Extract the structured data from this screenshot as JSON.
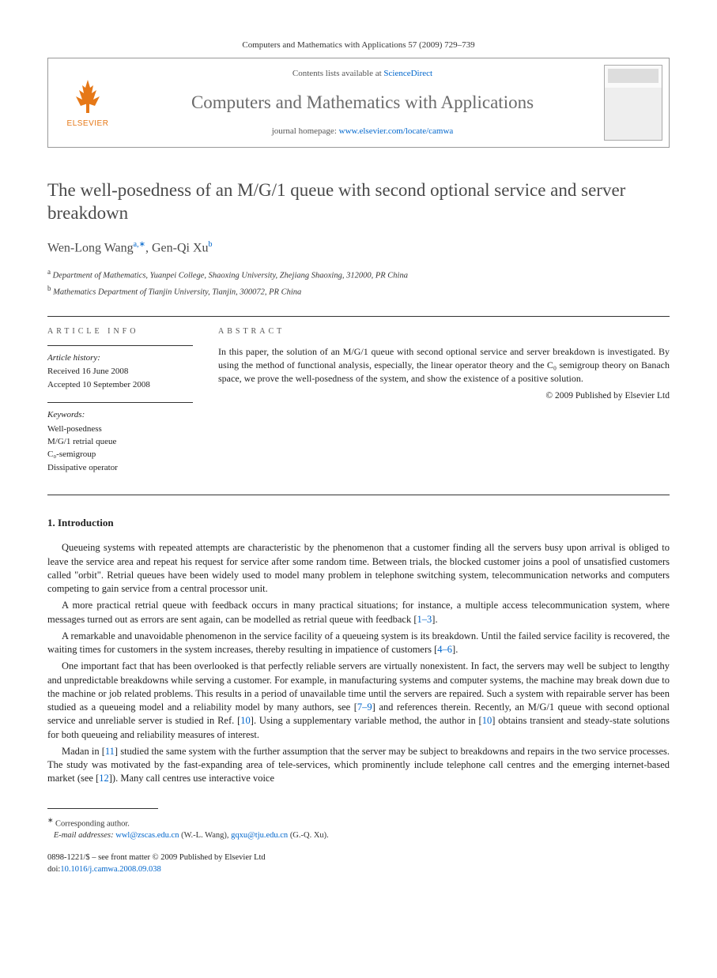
{
  "citation": "Computers and Mathematics with Applications 57 (2009) 729–739",
  "header": {
    "publisher": "ELSEVIER",
    "contents_prefix": "Contents lists available at ",
    "contents_link": "ScienceDirect",
    "journal": "Computers and Mathematics with Applications",
    "homepage_prefix": "journal homepage: ",
    "homepage_url": "www.elsevier.com/locate/camwa"
  },
  "title": "The well-posedness of an M/G/1 queue with second optional service and server breakdown",
  "authors_html": "Wen-Long Wang",
  "author1_sup": "a,∗",
  "author2": ", Gen-Qi Xu",
  "author2_sup": "b",
  "affiliations": {
    "a": "Department of Mathematics, Yuanpei College, Shaoxing University, Zhejiang Shaoxing, 312000, PR China",
    "b": "Mathematics Department of Tianjin University, Tianjin, 300072, PR China"
  },
  "article_info": {
    "label": "ARTICLE INFO",
    "history_title": "Article history:",
    "received": "Received 16 June 2008",
    "accepted": "Accepted 10 September 2008",
    "keywords_title": "Keywords:",
    "keywords": [
      "Well-posedness",
      "M/G/1 retrial queue",
      "C₀-semigroup",
      "Dissipative operator"
    ]
  },
  "abstract": {
    "label": "ABSTRACT",
    "text": "In this paper, the solution of an M/G/1 queue with second optional service and server breakdown is investigated. By using the method of functional analysis, especially, the linear operator theory and the C₀ semigroup theory on Banach space, we prove the well-posedness of the system, and show the existence of a positive solution.",
    "copyright": "© 2009 Published by Elsevier Ltd"
  },
  "section1": {
    "heading": "1. Introduction",
    "p1": "Queueing systems with repeated attempts are characteristic by the phenomenon that a customer finding all the servers busy upon arrival is obliged to leave the service area and repeat his request for service after some random time. Between trials, the blocked customer joins a pool of unsatisfied customers called \"orbit\". Retrial queues have been widely used to model many problem in telephone switching system, telecommunication networks and computers competing to gain service from a central processor unit.",
    "p2_a": "A more practical retrial queue with feedback occurs in many practical situations; for instance, a multiple access telecommunication system, where messages turned out as errors are sent again, can be modelled as retrial queue with feedback [",
    "p2_ref": "1–3",
    "p2_b": "].",
    "p3_a": "A remarkable and unavoidable phenomenon in the service facility of a queueing system is its breakdown. Until the failed service facility is recovered, the waiting times for customers in the system increases, thereby resulting in impatience of customers [",
    "p3_ref": "4–6",
    "p3_b": "].",
    "p4_a": "One important fact that has been overlooked is that perfectly reliable servers are virtually nonexistent. In fact, the servers may well be subject to lengthy and unpredictable breakdowns while serving a customer. For example, in manufacturing systems and computer systems, the machine may break down due to the machine or job related problems. This results in a period of unavailable time until the servers are repaired. Such a system with repairable server has been studied as a queueing model and a reliability model by many authors, see [",
    "p4_ref1": "7–9",
    "p4_b": "] and references therein. Recently, an M/G/1 queue with second optional service and unreliable server is studied in Ref. [",
    "p4_ref2": "10",
    "p4_c": "]. Using a supplementary variable method, the author in [",
    "p4_ref3": "10",
    "p4_d": "] obtains transient and steady-state solutions for both queueing and reliability measures of interest.",
    "p5_a": "Madan in [",
    "p5_ref1": "11",
    "p5_b": "] studied the same system with the further assumption that the server may be subject to breakdowns and repairs in the two service processes. The study was motivated by the fast-expanding area of tele-services, which prominently include telephone call centres and the emerging internet-based market (see [",
    "p5_ref2": "12",
    "p5_c": "]). Many call centres use interactive voice"
  },
  "footnote": {
    "corr": "Corresponding author.",
    "email_label": "E-mail addresses:",
    "email1": "wwl@zscas.edu.cn",
    "email1_who": " (W.-L. Wang), ",
    "email2": "gqxu@tju.edu.cn",
    "email2_who": " (G.-Q. Xu)."
  },
  "doi": {
    "line1": "0898-1221/$ – see front matter © 2009 Published by Elsevier Ltd",
    "prefix": "doi:",
    "value": "10.1016/j.camwa.2008.09.038"
  }
}
